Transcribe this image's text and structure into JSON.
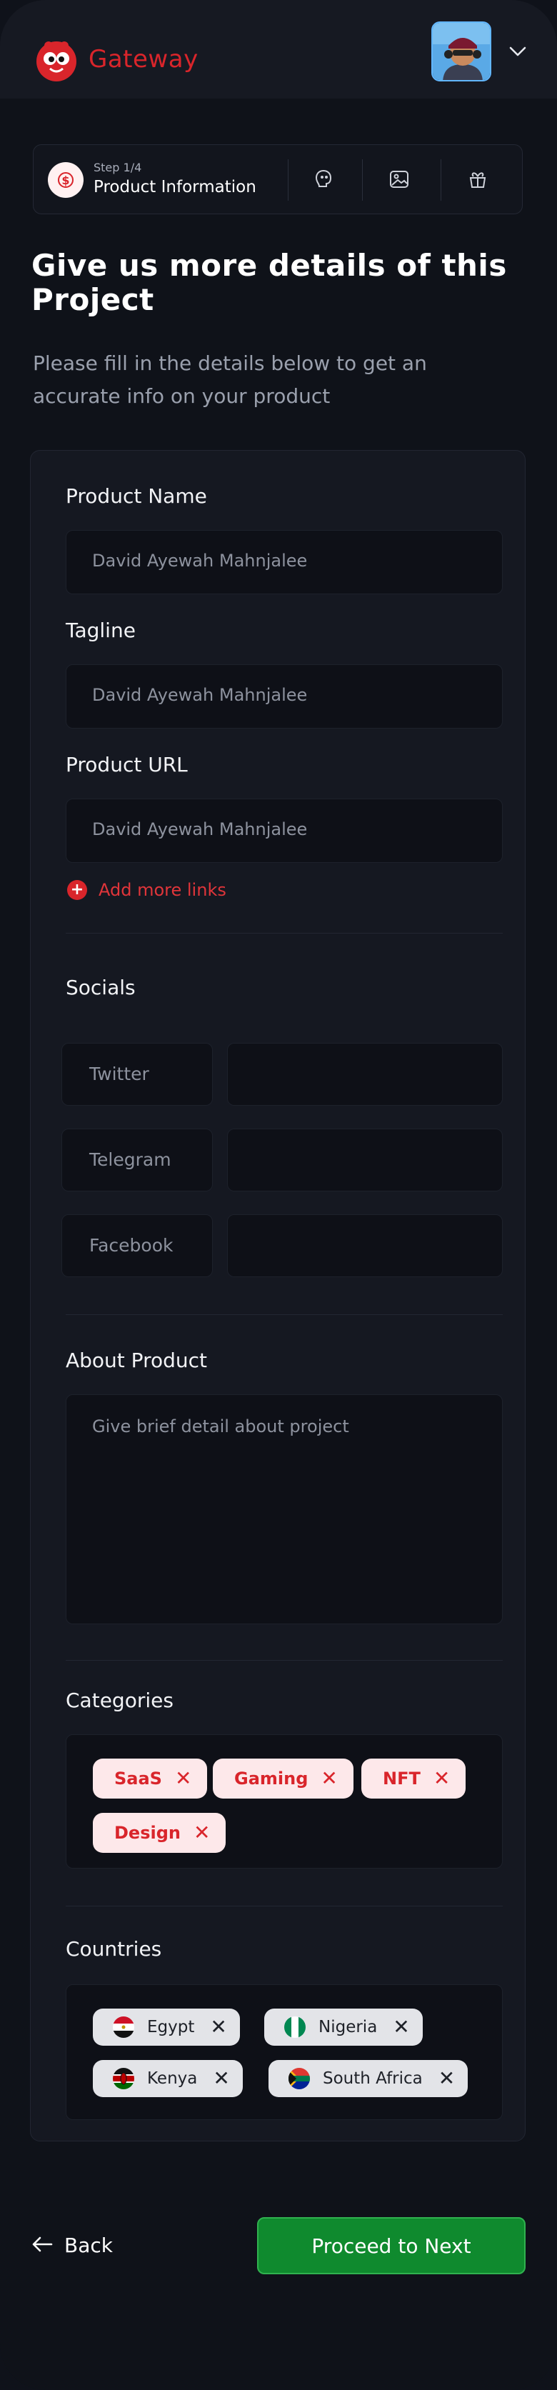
{
  "header": {
    "logo_text": "Gateway",
    "brand_color": "#d9252b",
    "avatar_icon": "user-avatar",
    "menu_icon": "chevron-down-icon"
  },
  "stepper": {
    "step_label": "Step 1/4",
    "title": "Product Information",
    "icons": [
      "product-icon",
      "face-icon",
      "image-icon",
      "gift-icon"
    ]
  },
  "page": {
    "title": "Give us more details of this Project",
    "subtitle": "Please fill in the details below to get an accurate info on your product"
  },
  "form": {
    "product_name": {
      "label": "Product Name",
      "value": "David Ayewah Mahnjalee"
    },
    "tagline": {
      "label": "Tagline",
      "value": "David Ayewah Mahnjalee"
    },
    "product_url": {
      "label": "Product URL",
      "value": "David Ayewah Mahnjalee"
    },
    "add_links": "Add more links",
    "socials": {
      "label": "Socials",
      "items": [
        {
          "name": "Twitter",
          "value": ""
        },
        {
          "name": "Telegram",
          "value": ""
        },
        {
          "name": "Facebook",
          "value": ""
        }
      ]
    },
    "about": {
      "label": "About Product",
      "placeholder": "Give brief detail about project"
    },
    "categories": {
      "label": "Categories",
      "items": [
        "SaaS",
        "Gaming",
        "NFT",
        "Design"
      ]
    },
    "countries": {
      "label": "Countries",
      "items": [
        "Egypt",
        "Nigeria",
        "Kenya",
        "South Africa"
      ]
    }
  },
  "footer": {
    "back_label": "Back",
    "proceed_label": "Proceed to Next",
    "proceed_color": "#0f8a2e"
  }
}
